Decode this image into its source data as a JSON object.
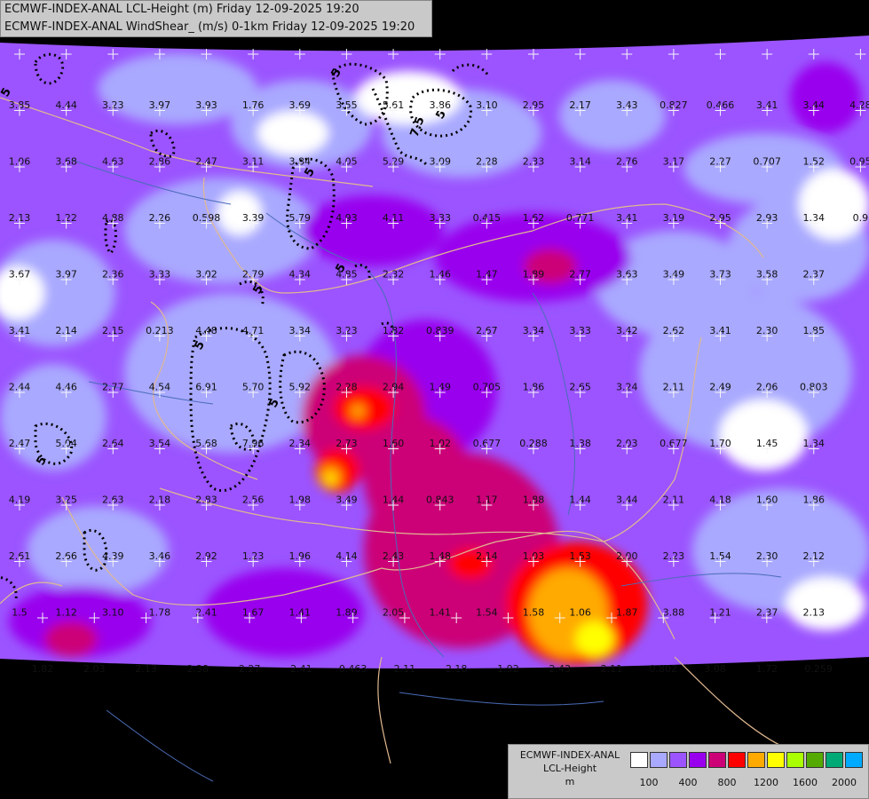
{
  "header": {
    "line1": "ECMWF-INDEX-ANAL LCL-Height (m) Friday 12-09-2025 19:20",
    "line2": "ECMWF-INDEX-ANAL WindShear_ (m/s) 0-1km Friday 12-09-2025 19:20"
  },
  "legend": {
    "line1": "ECMWF-INDEX-ANAL",
    "line2": "LCL-Height",
    "line3": "m",
    "colors": [
      "#ffffff",
      "#a9a9ff",
      "#9b54ff",
      "#9900ee",
      "#cc0077",
      "#ff0000",
      "#ffaa00",
      "#ffff00",
      "#aaff00",
      "#55aa00",
      "#00aa77",
      "#00aaff"
    ],
    "ticks": [
      "100",
      "400",
      "800",
      "1200",
      "1600",
      "2000"
    ]
  },
  "map": {
    "windshear_contour_labels": [
      "5",
      "5",
      "7.5",
      "5",
      "5",
      "5",
      "5",
      "5",
      "5",
      "5"
    ],
    "values": [
      [
        "3.85",
        "4.44",
        "3.23",
        "3.97",
        "3.93",
        "1.76",
        "3.69",
        "3.55",
        "5.61",
        "3.86",
        "3.10",
        "2.95",
        "2.17",
        "3.43",
        "0.827",
        "0.466",
        "3.41",
        "3.44",
        "4.28"
      ],
      [
        "1.06",
        "3.68",
        "4.63",
        "2.86",
        "2.47",
        "3.11",
        "3.84",
        "4.05",
        "5.29",
        "3.09",
        "2.28",
        "2.33",
        "3.14",
        "2.76",
        "3.17",
        "2.27",
        "0.707",
        "1.52",
        "0.95"
      ],
      [
        "2.13",
        "1.22",
        "4.88",
        "2.26",
        "0.598",
        "3.39",
        "5.79",
        "4.93",
        "4.11",
        "3.33",
        "0.415",
        "1.62",
        "0.771",
        "3.41",
        "3.19",
        "2.95",
        "2.93",
        "1.34",
        "0.9"
      ],
      [
        "3.67",
        "3.97",
        "2.36",
        "3.33",
        "3.02",
        "2.79",
        "4.34",
        "4.85",
        "2.32",
        "1.46",
        "1.47",
        "1.89",
        "2.77",
        "3.63",
        "3.49",
        "3.73",
        "3.58",
        "2.37"
      ],
      [
        "3.41",
        "2.14",
        "2.15",
        "0.213",
        "4.48",
        "4.71",
        "3.34",
        "3.23",
        "1.82",
        "0.839",
        "2.67",
        "3.34",
        "3.33",
        "3.42",
        "2.62",
        "3.41",
        "2.30",
        "1.85"
      ],
      [
        "2.44",
        "4.46",
        "2.77",
        "4.54",
        "6.91",
        "5.70",
        "5.92",
        "2.28",
        "2.94",
        "1.49",
        "0.705",
        "1.86",
        "2.65",
        "3.24",
        "2.11",
        "2.49",
        "2.06",
        "0.803"
      ],
      [
        "2.47",
        "5.04",
        "2.64",
        "3.54",
        "5.68",
        "7.96",
        "2.34",
        "2.73",
        "1.60",
        "1.02",
        "0.677",
        "0.288",
        "1.38",
        "2.03",
        "0.677",
        "1.70",
        "1.45",
        "1.34"
      ],
      [
        "4.19",
        "3.25",
        "2.63",
        "2.18",
        "2.83",
        "2.56",
        "1.98",
        "3.49",
        "1.44",
        "0.843",
        "1.17",
        "1.88",
        "1.44",
        "3.44",
        "2.11",
        "4.18",
        "1.60",
        "1.86"
      ],
      [
        "2.61",
        "2.66",
        "4.39",
        "3.46",
        "2.92",
        "1.23",
        "1.96",
        "4.14",
        "2.43",
        "1.48",
        "2.14",
        "1.03",
        "1.53",
        "2.00",
        "2.23",
        "1.54",
        "2.30",
        "2.12"
      ],
      [
        "1.5",
        "1.12",
        "3.10",
        "1.78",
        "2.41",
        "1.67",
        "1.41",
        "1.89",
        "2.05",
        "1.41",
        "1.54",
        "1.58",
        "1.06",
        "1.87",
        "3.88",
        "1.21",
        "2.37",
        "2.13"
      ],
      [
        "1.82",
        "2.03",
        "2.13",
        "2.38",
        "2.27",
        "2.41",
        "0.463",
        "2.11",
        "2.18",
        "1.92",
        "2.43",
        "2.11",
        "0.802",
        "3.08",
        "1.72",
        "0.259"
      ]
    ]
  }
}
